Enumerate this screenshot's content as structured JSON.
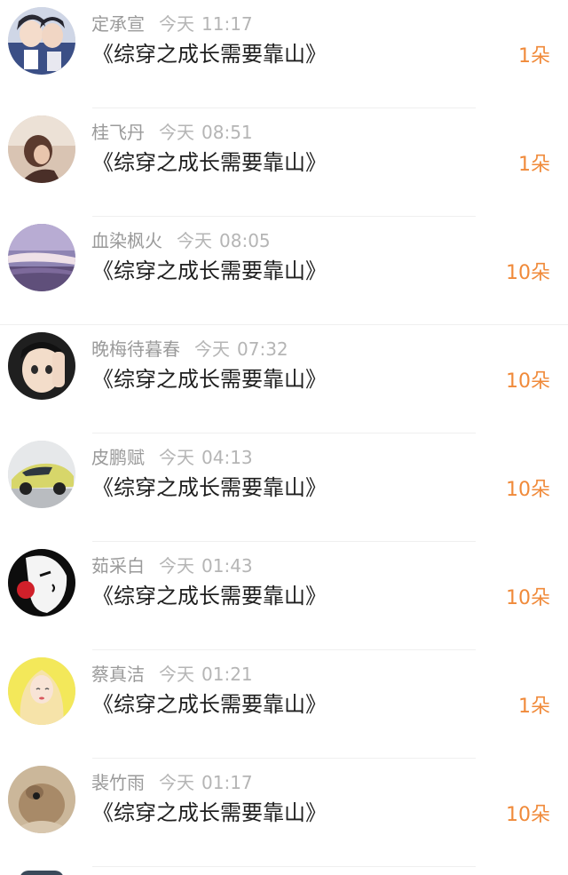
{
  "items": [
    {
      "name": "定承宣",
      "day": "今天",
      "time": "11:17",
      "title": "《综穿之成长需要靠山》",
      "count": "1朵"
    },
    {
      "name": "桂飞丹",
      "day": "今天",
      "time": "08:51",
      "title": "《综穿之成长需要靠山》",
      "count": "1朵"
    },
    {
      "name": "血染枫火",
      "day": "今天",
      "time": "08:05",
      "title": "《综穿之成长需要靠山》",
      "count": "10朵"
    },
    {
      "name": "晚梅待暮春",
      "day": "今天",
      "time": "07:32",
      "title": "《综穿之成长需要靠山》",
      "count": "10朵"
    },
    {
      "name": "皮鹏赋",
      "day": "今天",
      "time": "04:13",
      "title": "《综穿之成长需要靠山》",
      "count": "10朵"
    },
    {
      "name": "茹采白",
      "day": "今天",
      "time": "01:43",
      "title": "《综穿之成长需要靠山》",
      "count": "10朵"
    },
    {
      "name": "蔡真洁",
      "day": "今天",
      "time": "01:21",
      "title": "《综穿之成长需要靠山》",
      "count": "1朵"
    },
    {
      "name": "裴竹雨",
      "day": "今天",
      "time": "01:17",
      "title": "《综穿之成长需要靠山》",
      "count": "10朵"
    }
  ],
  "colors": {
    "count": "#f08a3a",
    "name": "#9a9a9a",
    "time": "#b5b5b5",
    "title": "#1f1f1f"
  }
}
